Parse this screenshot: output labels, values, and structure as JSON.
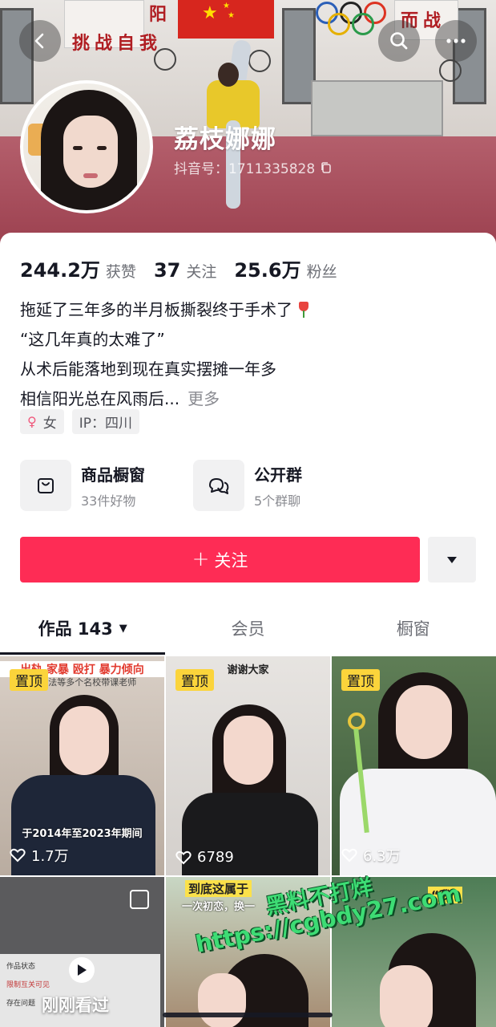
{
  "profile": {
    "name": "荔枝娜娜",
    "douyin_id": "抖音号：1711335828"
  },
  "cover_banners": {
    "left": "挑战自我",
    "top": "阳",
    "right": "而战"
  },
  "stats": [
    {
      "value": "244.2万",
      "label": "获赞"
    },
    {
      "value": "37",
      "label": "关注"
    },
    {
      "value": "25.6万",
      "label": "粉丝"
    }
  ],
  "bio": {
    "lines": [
      "拖延了三年多的半月板撕裂终于手术了",
      "“这几年真的太难了”",
      "从术后能落地到现在真实摆摊一年多",
      "相信阳光总在风雨后..."
    ],
    "more": "更多"
  },
  "tags": {
    "gender": "女",
    "gender_symbol": "♀",
    "ip": "IP：四川"
  },
  "entries": [
    {
      "title": "商品橱窗",
      "sub": "33件好物",
      "icon": "shopping-bag-icon"
    },
    {
      "title": "公开群",
      "sub": "5个群聊",
      "icon": "group-chat-icon"
    }
  ],
  "actions": {
    "follow": "关注",
    "follow_plus": "+"
  },
  "tabs": [
    {
      "label": "作品 143",
      "active": true
    },
    {
      "label": "会员",
      "active": false
    },
    {
      "label": "橱窗",
      "active": false
    }
  ],
  "videos": [
    {
      "pinned": "置顶",
      "likes": "1.7万",
      "top_text": "出轨 家暴 殴打 暴力倾向",
      "sub_text": "于2014年至2023年期间",
      "small_text": "师 数法等多个名校带课老师"
    },
    {
      "pinned": "置顶",
      "likes": "6789",
      "top_text": "谢谢大家"
    },
    {
      "pinned": "置顶",
      "likes": "6.3万"
    },
    {
      "recent_label": "刚刚看过",
      "card_title": "作品状态",
      "card_line1": "限制互关可见",
      "card_line2": "存在问题"
    },
    {
      "top_text": "到底这属于",
      "top_text2": "一次初恋，换一"
    },
    {
      "top_text": "“我”"
    }
  ],
  "watermark": {
    "line1": "黑料不打烊",
    "line2": "https://cgbdy27.com"
  },
  "colors": {
    "accent": "#fe2c55",
    "pin": "#fbd43b",
    "watermark": "#3ddc74"
  }
}
